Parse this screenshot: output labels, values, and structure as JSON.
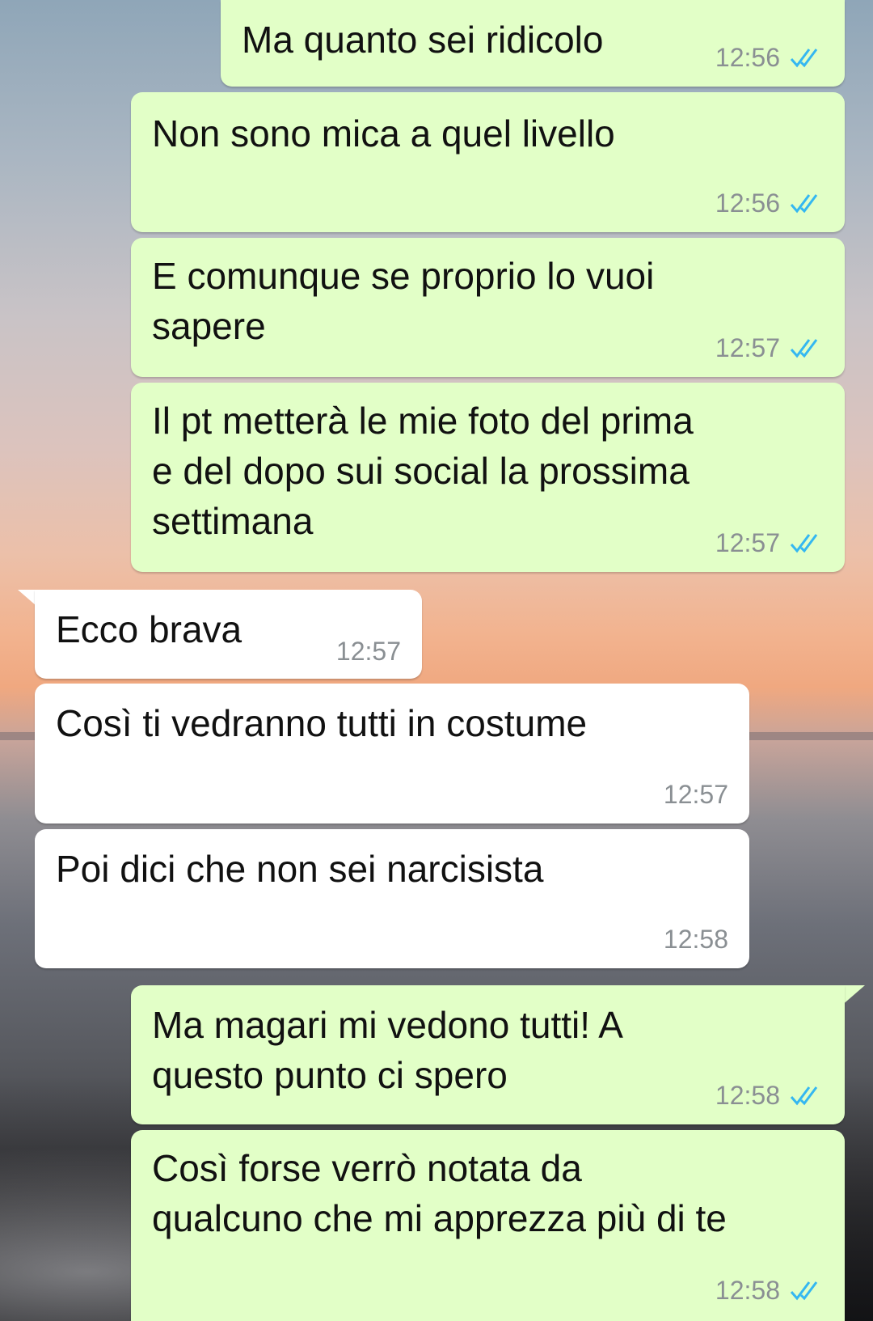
{
  "messages": [
    {
      "text": "Ma quanto sei ridicolo",
      "time": "12:56",
      "icon": "double-check-read-icon"
    },
    {
      "text": "Non sono mica a quel livello",
      "time": "12:56",
      "icon": "double-check-read-icon"
    },
    {
      "text": "E comunque se proprio lo vuoi\nsapere",
      "time": "12:57",
      "icon": "double-check-read-icon"
    },
    {
      "text": "Il pt metterà le mie foto del prima\ne del dopo sui social la prossima\nsettimana",
      "time": "12:57",
      "icon": "double-check-read-icon"
    },
    {
      "text": "Ecco brava",
      "time": "12:57"
    },
    {
      "text": "Così ti vedranno tutti in costume",
      "time": "12:57"
    },
    {
      "text": "Poi dici che non sei narcisista",
      "time": "12:58"
    },
    {
      "text": "Ma magari mi vedono tutti! A\nquesto punto ci spero",
      "time": "12:58",
      "icon": "double-check-read-icon"
    },
    {
      "text": "Così forse verrò notata da\nqualcuno che mi apprezza più di te",
      "time": "12:58",
      "icon": "double-check-read-icon"
    }
  ],
  "colors": {
    "outgoing_bubble": "#e2ffc7",
    "incoming_bubble": "#ffffff",
    "read_ticks": "#34b7f1",
    "timestamp": "#8a8f93"
  }
}
